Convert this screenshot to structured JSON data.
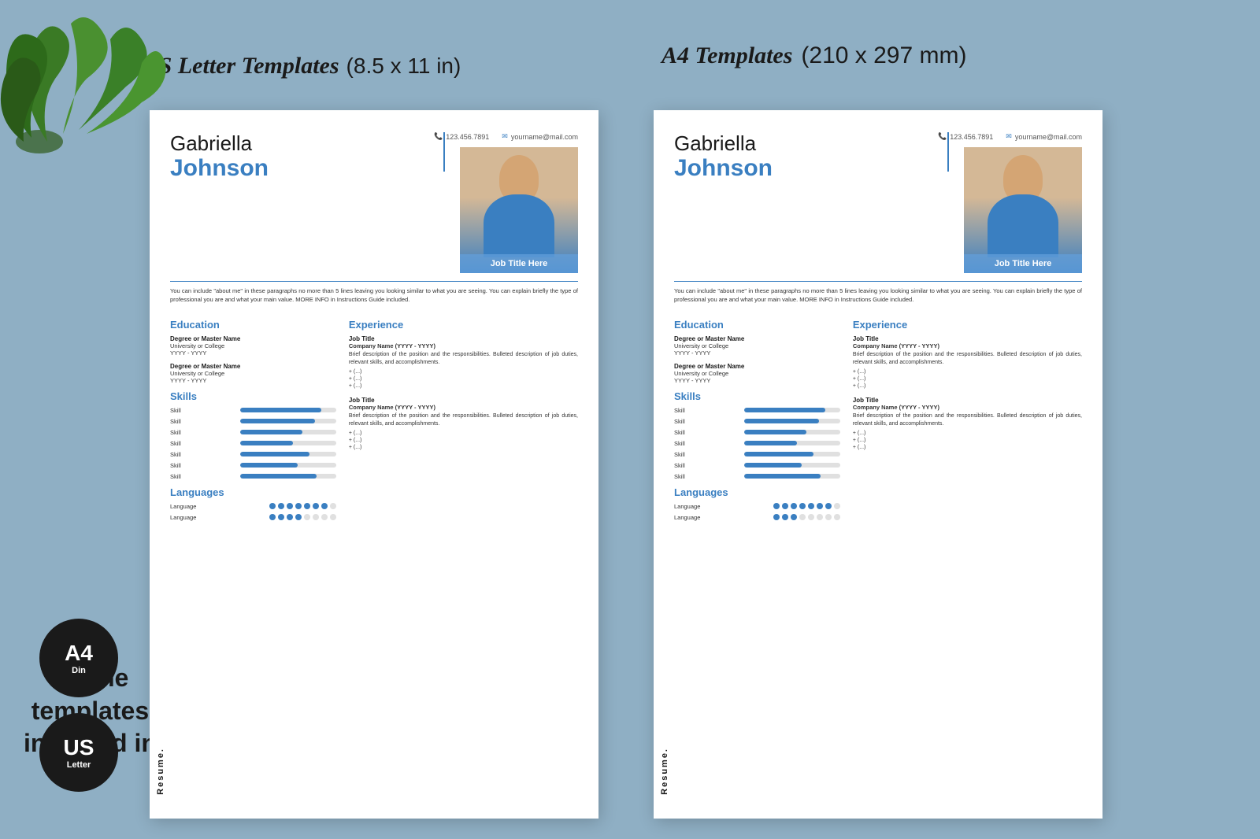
{
  "page": {
    "background_color": "#8fafc4",
    "title_us": "US Letter Templates",
    "title_us_size": "(8.5 x 11 in)",
    "title_a4": "A4 Templates",
    "title_a4_size": "(210 x 297 mm)",
    "bottom_text": "All the\ntemplates\nincluded in",
    "badge_a4_label": "A4",
    "badge_a4_sub": "Din",
    "badge_us_label": "US",
    "badge_us_sub": "Letter"
  },
  "resume": {
    "first_name": "Gabriella",
    "last_name": "Johnson",
    "phone": "123.456.7891",
    "email": "yourname@mail.com",
    "about": "You can include \"about me\" in these paragraphs no more than 5 lines leaving you looking similar to what you are seeing. You can explain briefly the type of professional you are and what your main value. MORE INFO in Instructions Guide included.",
    "photo_label": "Job Title Here",
    "sections": {
      "education": {
        "title": "Education",
        "entries": [
          {
            "degree": "Degree or Master Name",
            "school": "University or College",
            "year": "YYYY - YYYY"
          },
          {
            "degree": "Degree or Master Name",
            "school": "University or College",
            "year": "YYYY - YYYY"
          }
        ]
      },
      "skills": {
        "title": "Skills",
        "items": [
          {
            "name": "Skill",
            "pct": 85
          },
          {
            "name": "Skill",
            "pct": 78
          },
          {
            "name": "Skill",
            "pct": 70
          },
          {
            "name": "Skill",
            "pct": 60
          },
          {
            "name": "Skill",
            "pct": 75
          },
          {
            "name": "Skill",
            "pct": 65
          },
          {
            "name": "Skill",
            "pct": 80
          }
        ]
      },
      "languages": {
        "title": "Languages",
        "items": [
          {
            "name": "Language",
            "filled": 7,
            "total": 8
          },
          {
            "name": "Language",
            "filled": 4,
            "total": 8
          }
        ]
      },
      "experience": {
        "title": "Experience",
        "entries": [
          {
            "title": "Job Title",
            "company": "Company Name (YYYY - YYYY)",
            "desc": "Brief description of the position and the responsibilities. Bulleted description of job duties, relevant skills, and accomplishments.",
            "bullets": [
              "+ (...)",
              "+ (...)",
              "+ (...)"
            ]
          },
          {
            "title": "Job Title",
            "company": "Company Name (YYYY - YYYY)",
            "desc": "Brief description of the position and the responsibilities. Bulleted description of job duties, relevant skills, and accomplishments.",
            "bullets": [
              "+ (...)",
              "+ (...)",
              "+ (...)"
            ]
          }
        ]
      }
    }
  }
}
